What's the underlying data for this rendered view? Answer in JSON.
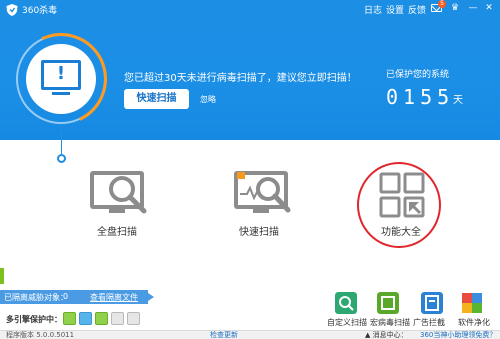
{
  "app": {
    "title": "360杀毒"
  },
  "titlebar": {
    "log": "日志",
    "settings": "设置",
    "feedback": "反馈",
    "mail_count": "5",
    "skin_glyph": "♛",
    "min_glyph": "—",
    "close_glyph": "✕"
  },
  "status": {
    "alert": "您已超过30天未进行病毒扫描了，建议您立即扫描！",
    "scan_button": "快速扫描",
    "ignore": "忽略",
    "protected_label": "已保护您的系统",
    "protected_days": "0155",
    "protected_unit": "天",
    "warn_glyph": "!"
  },
  "tiles": [
    {
      "label": "全盘扫描",
      "icon": "full-scan-icon"
    },
    {
      "label": "快速扫描",
      "icon": "quick-scan-icon"
    },
    {
      "label": "功能大全",
      "icon": "feature-grid-icon"
    }
  ],
  "quarantine": {
    "label": "已隔离威胁对象：",
    "count": "0",
    "link": "查看隔离文件"
  },
  "engines": {
    "label": "多引擎保护中："
  },
  "tools": [
    {
      "label": "自定义扫描",
      "icon": "custom-scan-icon"
    },
    {
      "label": "宏病毒扫描",
      "icon": "macro-scan-icon"
    },
    {
      "label": "广告拦截",
      "icon": "ad-block-icon"
    },
    {
      "label": "软件净化",
      "icon": "software-clean-icon"
    }
  ],
  "footer": {
    "version": "程序版本 5.0.0.5011",
    "update": "检查更新",
    "center": "▲ 消息中心：",
    "promo": "360当神小助理领免费？"
  },
  "colors": {
    "header_blue": "#1b8ee6",
    "accent_orange": "#ff9a1f",
    "highlight_red": "#e0262b",
    "engine_green": "#8fd14a"
  }
}
